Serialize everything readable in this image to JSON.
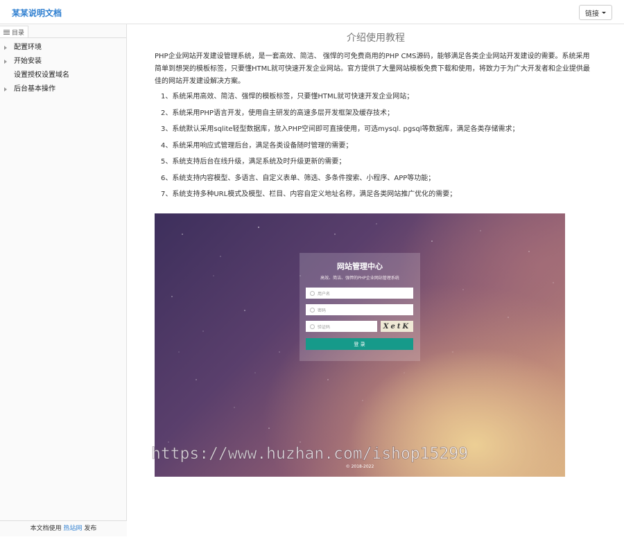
{
  "header": {
    "brand": "某某说明文档",
    "links_label": "链接"
  },
  "sidebar": {
    "tab_label": "目录",
    "items": [
      {
        "label": "配置环境",
        "expandable": true
      },
      {
        "label": "开始安装",
        "expandable": true
      },
      {
        "label": "设置授权设置域名",
        "expandable": false
      },
      {
        "label": "后台基本操作",
        "expandable": true
      }
    ],
    "footer": {
      "prefix": "本文档使用 ",
      "link": "热站网",
      "suffix": " 发布"
    }
  },
  "main": {
    "title": "介绍使用教程",
    "intro": "PHP企业网站开发建设管理系统，是一套高效、简洁、 强悍的可免费商用的PHP CMS源码，能够满足各类企业网站开发建设的需要。系统采用简单到想哭的模板标签，只要懂HTML就可快速开发企业网站。官方提供了大量网站模板免费下载和使用，将致力于为广大开发者和企业提供最佳的网站开发建设解决方案。",
    "features": [
      "1、系统采用高效、简洁、强悍的模板标签，只要懂HTML就可快速开发企业网站；",
      "2、系统采用PHP语言开发，使用自主研发的高速多层开发框架及缓存技术；",
      "3、系统默认采用sqlite轻型数据库，放入PHP空间即可直接使用，可选mysql. pgsql等数据库，满足各类存储需求；",
      "4、系统采用响应式管理后台，满足各类设备随时管理的需要；",
      "5、系统支持后台在线升级，满足系统及时升级更新的需要；",
      "6、系统支持内容模型、多语言、自定义表单、筛选、多条件搜索、小程序、APP等功能；",
      "7、系统支持多种URL模式及模型、栏目、内容自定义地址名称，满足各类网站推广优化的需要；"
    ],
    "screenshot": {
      "login_title": "网站管理中心",
      "login_subtitle": "高效、简洁、强悍的PHP企业网站管理系统",
      "username_placeholder": "用户名",
      "password_placeholder": "密码",
      "captcha_placeholder": "验证码",
      "captcha_text": "XetK",
      "login_button": "登 录",
      "copyright": "© 2018-2022"
    },
    "watermark": "https://www.huzhan.com/ishop15299"
  },
  "colors": {
    "brand": "#2f7fd0",
    "login_button": "#169a8a"
  }
}
